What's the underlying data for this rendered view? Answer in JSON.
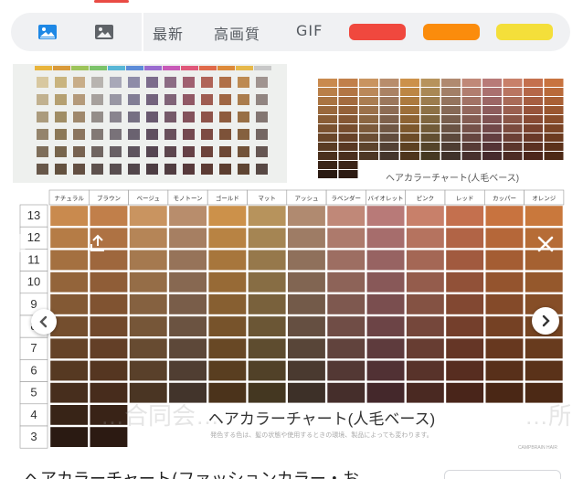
{
  "toolbar": {
    "filters": [
      {
        "label": "最新"
      },
      {
        "label": "高画質"
      },
      {
        "label": "GIF"
      }
    ],
    "color_swatches": [
      {
        "name": "red",
        "color": "#f0483e"
      },
      {
        "name": "orange",
        "color": "#fb8c0c"
      },
      {
        "name": "yellow",
        "color": "#f4df3a"
      }
    ],
    "accent_color": "#1e88e5",
    "icons": [
      "image-type-all-icon",
      "image-type-photo-icon"
    ]
  },
  "thumbnails": {
    "right_caption": "ヘアカラーチャート(人毛ベース)"
  },
  "viewer": {
    "columns": [
      "ナチュラル",
      "ブラウン",
      "ベージュ",
      "モノトーン",
      "ゴールド",
      "マット",
      "アッシュ",
      "ラベンダー",
      "バイオレット",
      "ピンク",
      "レッド",
      "カッパー",
      "オレンジ"
    ],
    "rows": [
      "13",
      "12",
      "11",
      "10",
      "9",
      "8",
      "7",
      "6",
      "5",
      "4",
      "3"
    ],
    "title": "ヘアカラーチャート(人毛ベース)",
    "subtitle": "発色する色は、髪の状態や使用するときの環境、製品によっても変わります。",
    "credit": "CAMPBRAIN HAIR",
    "watermark": "…合同会…",
    "watermark_right": "…所",
    "icons": [
      "share-icon",
      "close-icon",
      "chevron-left-icon",
      "chevron-right-icon"
    ]
  },
  "caption": {
    "text": "ヘアカラーチャート(ファッションカラー・お"
  }
}
